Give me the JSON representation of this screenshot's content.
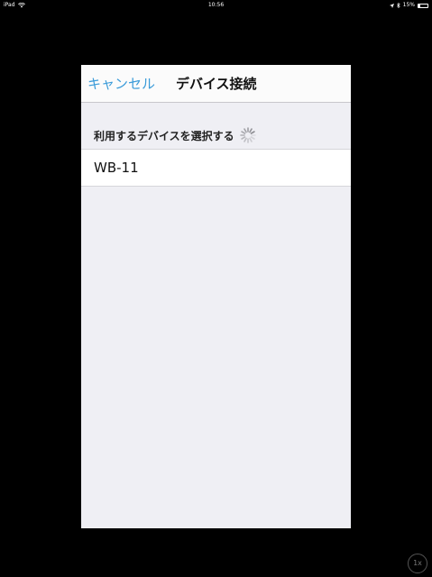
{
  "status_bar": {
    "device": "iPad",
    "time": "10:56",
    "battery_percent": "15%",
    "battery_level": 0.15
  },
  "dialog": {
    "cancel_label": "キャンセル",
    "title": "デバイス接続",
    "section_header": "利用するデバイスを選択する",
    "devices": [
      "WB-11"
    ]
  },
  "zoom": {
    "label": "1x"
  },
  "colors": {
    "accent": "#3a9bd9",
    "panel_bg": "#efeff4",
    "nav_bg": "#fbfbfb"
  },
  "icons": {
    "wifi": "wifi-icon",
    "location": "location-icon",
    "bluetooth": "bluetooth-icon",
    "battery": "battery-icon",
    "spinner": "activity-spinner-icon"
  }
}
